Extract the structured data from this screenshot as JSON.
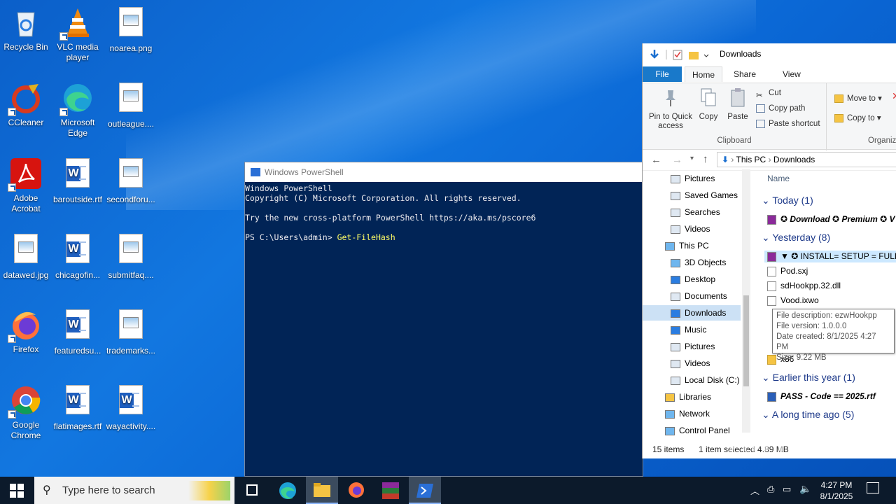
{
  "desktop": {
    "icons": [
      {
        "label": "Recycle Bin"
      },
      {
        "label": "VLC media player"
      },
      {
        "label": "noarea.png"
      },
      {
        "label": "CCleaner"
      },
      {
        "label": "Microsoft Edge"
      },
      {
        "label": "outleague...."
      },
      {
        "label": "Adobe Acrobat"
      },
      {
        "label": "baroutside.rtf"
      },
      {
        "label": "secondforu..."
      },
      {
        "label": "datawed.jpg"
      },
      {
        "label": "chicagofin..."
      },
      {
        "label": "submitfaq...."
      },
      {
        "label": "Firefox"
      },
      {
        "label": "featuredsu..."
      },
      {
        "label": "trademarks..."
      },
      {
        "label": "Google Chrome"
      },
      {
        "label": "flatimages.rtf"
      },
      {
        "label": "wayactivity...."
      }
    ]
  },
  "powershell": {
    "title": "Windows PowerShell",
    "lines": [
      "Windows PowerShell",
      "Copyright (C) Microsoft Corporation. All rights reserved.",
      "",
      "Try the new cross-platform PowerShell https://aka.ms/pscore6",
      ""
    ],
    "prompt": "PS C:\\Users\\admin> ",
    "command": "Get-FileHash"
  },
  "explorer": {
    "title": "Downloads",
    "tabs": {
      "file": "File",
      "home": "Home",
      "share": "Share",
      "view": "View"
    },
    "ribbon": {
      "pin": "Pin to Quick access",
      "copy": "Copy",
      "paste": "Paste",
      "cut": "Cut",
      "copy_path": "Copy path",
      "paste_shortcut": "Paste shortcut",
      "move_to": "Move to",
      "copy_to": "Copy to",
      "clipboard": "Clipboard",
      "organize": "Organiz"
    },
    "address": {
      "this_pc": "This PC",
      "downloads": "Downloads"
    },
    "nav": [
      "Pictures",
      "Saved Games",
      "Searches",
      "Videos",
      "This PC",
      "3D Objects",
      "Desktop",
      "Documents",
      "Downloads",
      "Music",
      "Pictures",
      "Videos",
      "Local Disk (C:)",
      "Libraries",
      "Network",
      "Control Panel"
    ],
    "column_name": "Name",
    "groups": {
      "today": "Today (1)",
      "yesterday": "Yesterday (8)",
      "earlier": "Earlier this year (1)",
      "long_ago": "A long time ago (5)"
    },
    "files": {
      "today1": "✪ Download ✪ Premium ✪ V",
      "install": "▼ ✪ INSTALL= SETUP = FULL",
      "pod": "Pod.sxj",
      "sdhook": "sdHookpp.32.dll",
      "vood": "Vood.ixwo",
      "x86": "x86",
      "pass": "PASS - Code == 2025.rtf"
    },
    "tooltip": {
      "desc": "File description: ezwHookpp",
      "version": "File version: 1.0.0.0",
      "created": "Date created: 8/1/2025 4:27 PM",
      "size": "Size: 9.22 MB"
    },
    "status": {
      "items": "15 items",
      "selected": "1 item selected  4.89 MB"
    }
  },
  "taskbar": {
    "search_placeholder": "Type here to search",
    "time": "4:27 PM",
    "date": "8/1/2025"
  },
  "watermark": "ANY RUN"
}
